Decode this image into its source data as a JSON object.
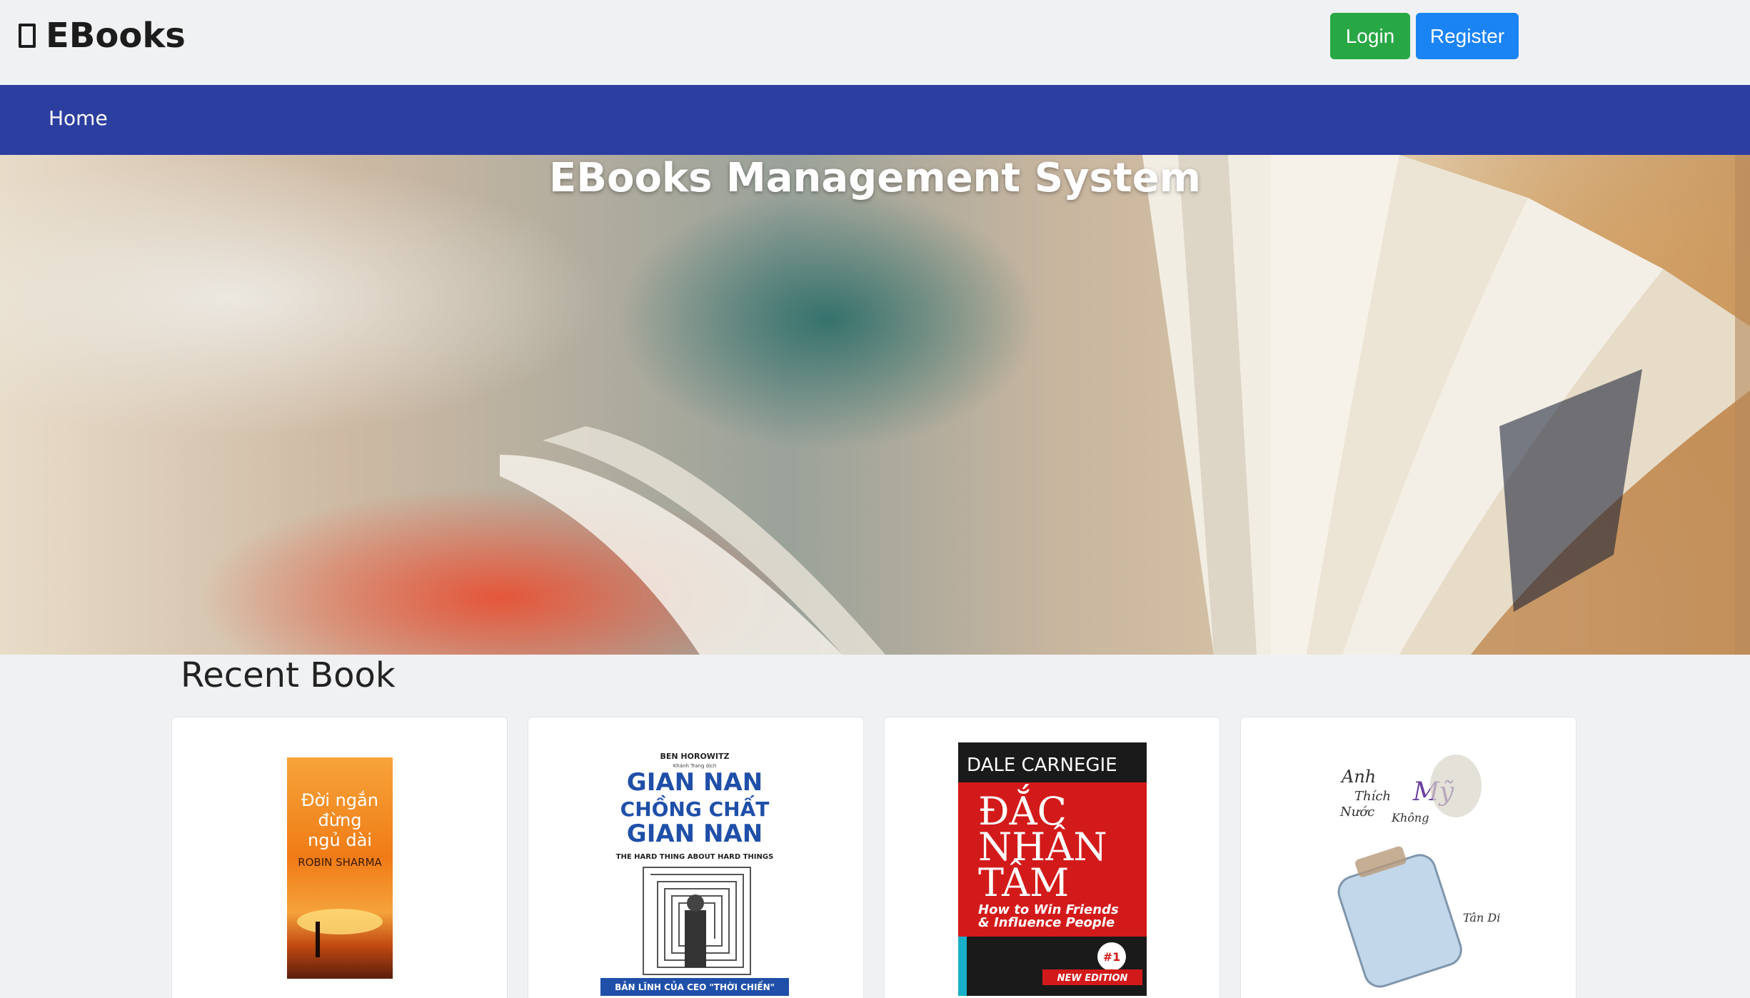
{
  "header": {
    "brand": "EBooks",
    "brand_icon": "book-icon",
    "login_label": "Login",
    "register_label": "Register"
  },
  "nav": {
    "items": [
      {
        "label": "Home"
      }
    ]
  },
  "hero": {
    "title": "EBooks Management System"
  },
  "recent": {
    "title": "Recent Book",
    "books": [
      {
        "cover_top": "Đời ngắn",
        "cover_mid": "đừng",
        "cover_bot": "ngủ dài",
        "author": "ROBIN SHARMA"
      },
      {
        "author": "BEN HOROWITZ",
        "translator": "Khánh Trang dịch",
        "line1": "GIAN NAN",
        "line2": "CHỒNG CHẤT",
        "line3": "GIAN NAN",
        "subtitle": "THE HARD THING ABOUT HARD THINGS",
        "footer": "BẢN LĨNH CỦA CEO \"THỜI CHIẾN\""
      },
      {
        "author": "DALE CARNEGIE",
        "line1": "ĐẮC",
        "line2": "NHÂN",
        "line3": "TÂM",
        "subtitle1": "How to Win Friends",
        "subtitle2": "& Influence People",
        "badge": "NEW EDITION"
      },
      {
        "line1": "Anh",
        "line2": "Thích",
        "line3": "Nước",
        "line4": "Mỹ",
        "line5": "Không",
        "author": "Tân Di Ổ"
      }
    ]
  },
  "colors": {
    "login": "#28a745",
    "register": "#1a84f4",
    "navbar": "#2d3ea1"
  }
}
